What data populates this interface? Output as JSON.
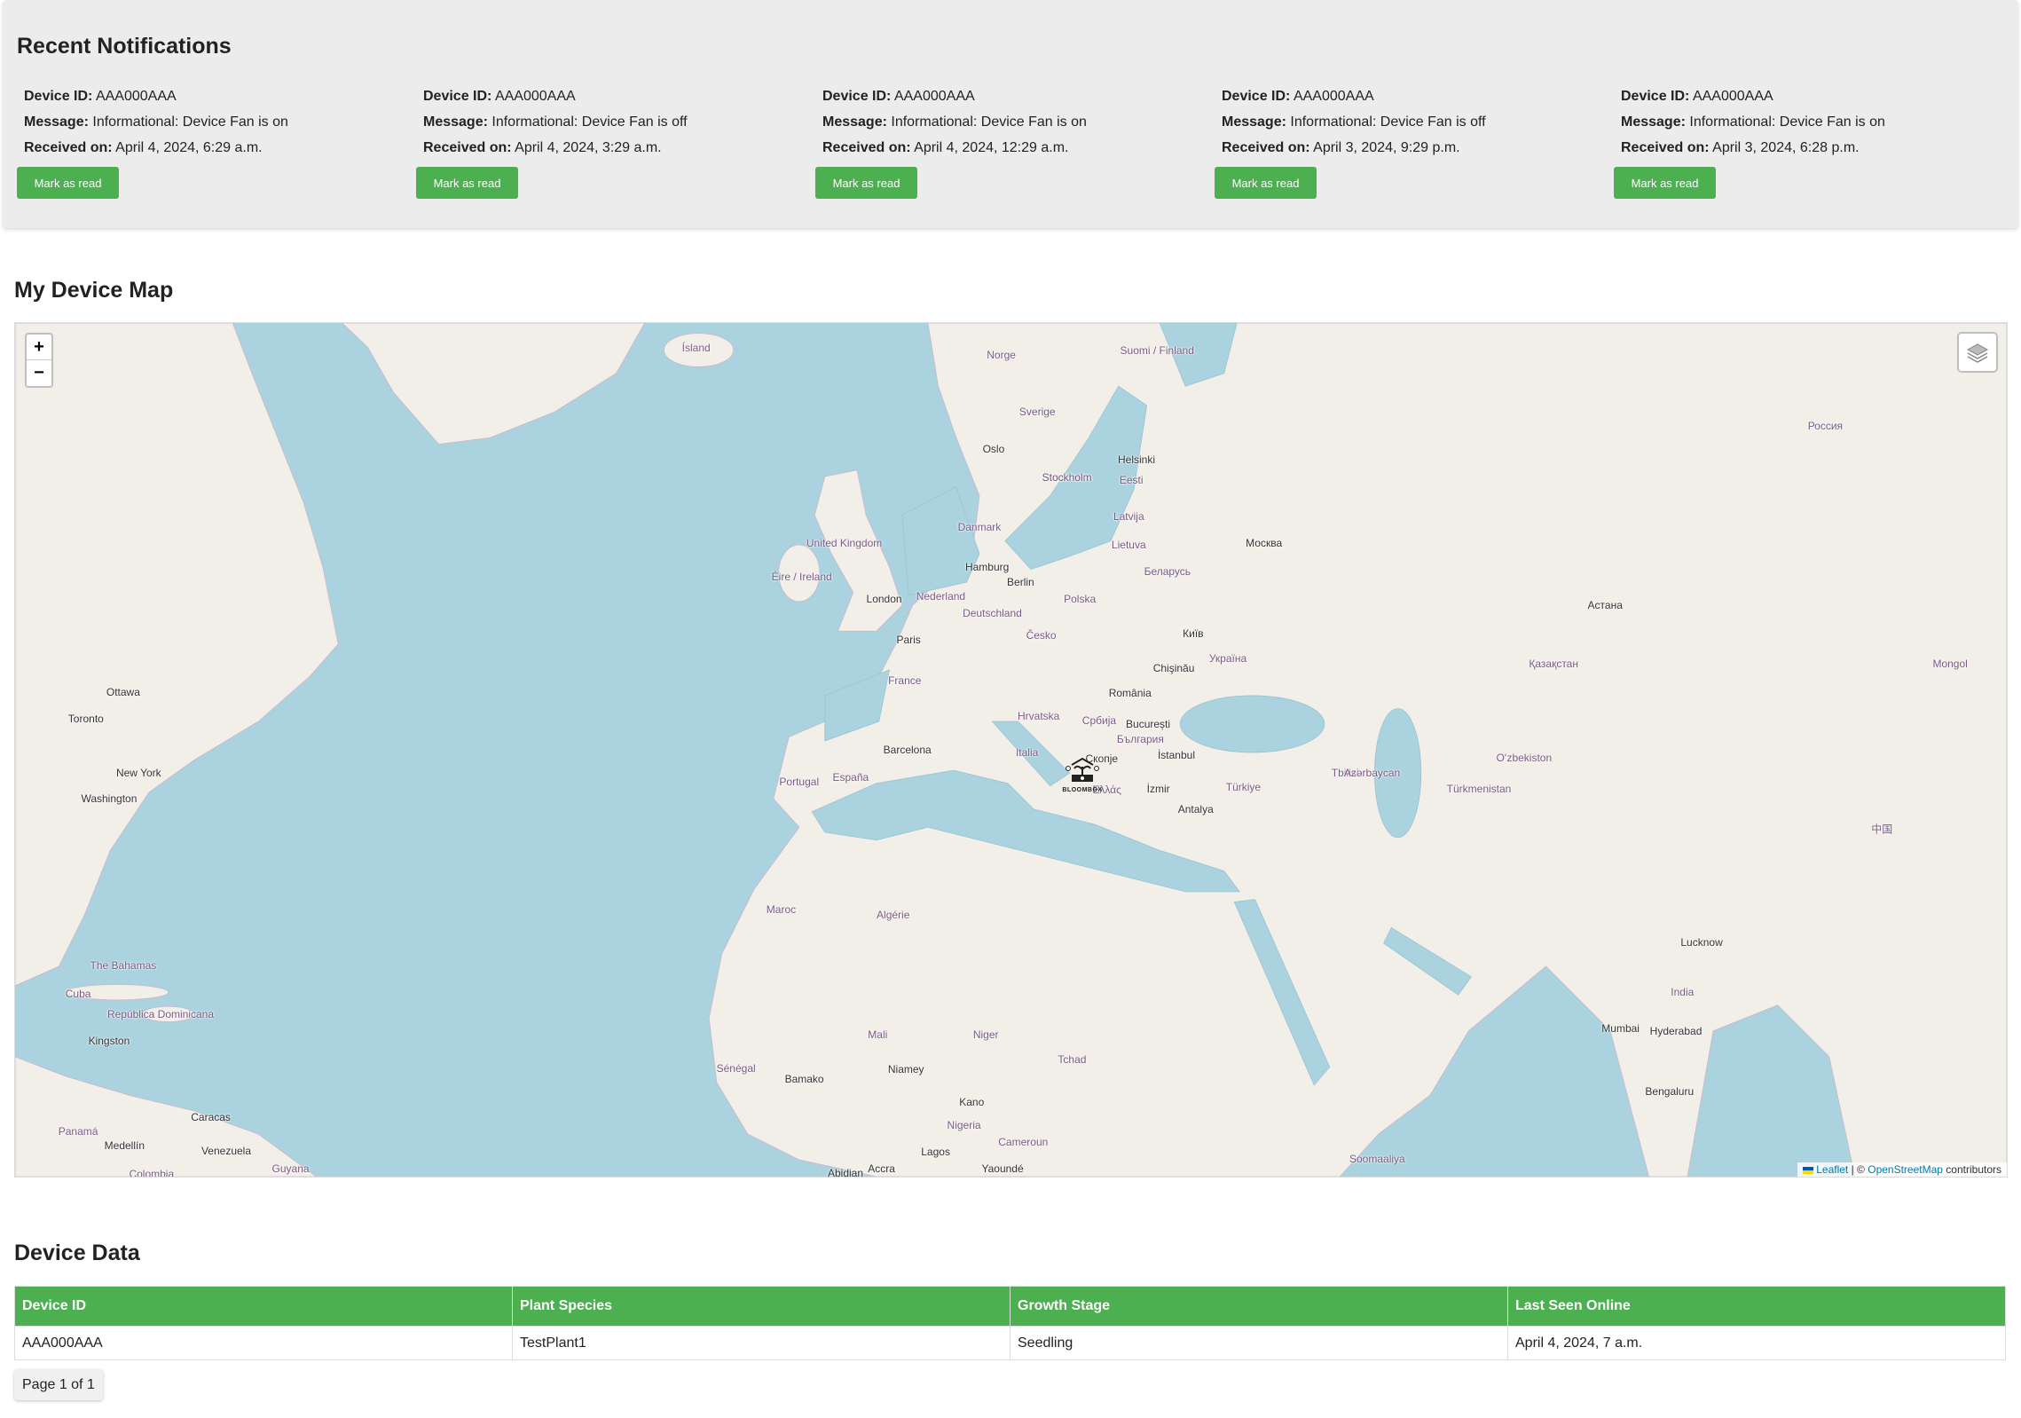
{
  "notifications": {
    "title": "Recent Notifications",
    "labels": {
      "device_id": "Device ID:",
      "message": "Message:",
      "received": "Received on:"
    },
    "mark_read_label": "Mark as read",
    "items": [
      {
        "device_id": "AAA000AAA",
        "message": "Informational: Device Fan is on",
        "received": "April 4, 2024, 6:29 a.m."
      },
      {
        "device_id": "AAA000AAA",
        "message": "Informational: Device Fan is off",
        "received": "April 4, 2024, 3:29 a.m."
      },
      {
        "device_id": "AAA000AAA",
        "message": "Informational: Device Fan is on",
        "received": "April 4, 2024, 12:29 a.m."
      },
      {
        "device_id": "AAA000AAA",
        "message": "Informational: Device Fan is off",
        "received": "April 3, 2024, 9:29 p.m."
      },
      {
        "device_id": "AAA000AAA",
        "message": "Informational: Device Fan is on",
        "received": "April 3, 2024, 6:28 p.m."
      }
    ]
  },
  "map": {
    "title": "My Device Map",
    "zoom_in": "+",
    "zoom_out": "−",
    "layers_icon": "layers-icon",
    "marker_logo_text": "BLOOMBOX",
    "attribution": {
      "leaflet": "Leaflet",
      "sep": "| ©",
      "osm": "OpenStreetMap",
      "suffix": "contributors"
    },
    "colors": {
      "water": "#aad3df",
      "land": "#f2efe9"
    },
    "labels": [
      "Ísland",
      "Norge",
      "Sverige",
      "Suomi / Finland",
      "Oslo",
      "Stockholm",
      "Helsinki",
      "Eesti",
      "Latvija",
      "Lietuva",
      "Danmark",
      "United Kingdom",
      "Éire / Ireland",
      "London",
      "Hamburg",
      "Berlin",
      "Nederland",
      "Deutschland",
      "Polska",
      "Беларусь",
      "Москва",
      "Paris",
      "France",
      "Česko",
      "Україна",
      "Київ",
      "Italia",
      "Hrvatska",
      "Србија",
      "România",
      "București",
      "България",
      "Скопје",
      "Ελλάς",
      "İstanbul",
      "Türkiye",
      "İzmir",
      "Antalya",
      "España",
      "Barcelona",
      "Portugal",
      "Россия",
      "Қазақстан",
      "Астана",
      "Oʻzbekiston",
      "Türkmenistan",
      "Algérie",
      "Maroc",
      "Mali",
      "Niger",
      "Tchad",
      "Nigeria",
      "Ottawa",
      "Toronto",
      "New York",
      "Washington",
      "The Bahamas",
      "Cuba",
      "India",
      "Mumbai",
      "Lucknow",
      "Hyderabad",
      "Bengaluru",
      "Sénégal",
      "Bamako",
      "Niamey",
      "Kano",
      "Lagos",
      "Accra",
      "Abidjan",
      "Cameroun",
      "Yaoundé",
      "Kingston",
      "Caracas",
      "Venezuela",
      "Guyana",
      "Colombia",
      "Medellín",
      "Panamá",
      "República Dominicana",
      "Soomaaliya",
      "Mongol",
      "中国",
      "Chişinău",
      "Tbilisi",
      "Azərbaycan",
      "Stockholm"
    ]
  },
  "device_data": {
    "title": "Device Data",
    "columns": [
      "Device ID",
      "Plant Species",
      "Growth Stage",
      "Last Seen Online"
    ],
    "rows": [
      [
        "AAA000AAA",
        "TestPlant1",
        "Seedling",
        "April 4, 2024, 7 a.m."
      ]
    ],
    "pagination": "Page 1 of 1",
    "header_color": "#4caf50"
  }
}
